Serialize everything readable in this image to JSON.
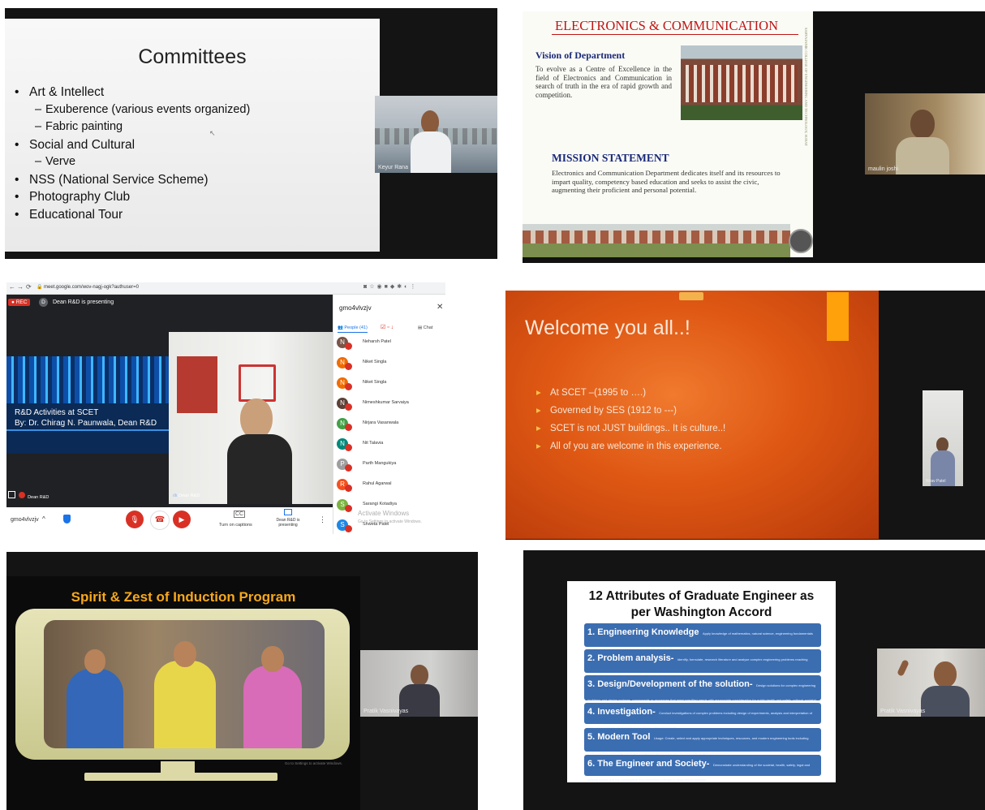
{
  "panel1": {
    "title": "Committees",
    "items": [
      {
        "level": 1,
        "text": "Art & Intellect"
      },
      {
        "level": 2,
        "text": "Exuberence (various events organized)"
      },
      {
        "level": 2,
        "text": "Fabric painting"
      },
      {
        "level": 1,
        "text": "Social and Cultural"
      },
      {
        "level": 2,
        "text": "Verve"
      },
      {
        "level": 1,
        "text": "NSS (National Service Scheme)"
      },
      {
        "level": 1,
        "text": "Photography Club"
      },
      {
        "level": 1,
        "text": "Educational Tour"
      }
    ],
    "participant": "Keyur Rana"
  },
  "panel2": {
    "title": "ELECTRONICS & COMMUNICATION",
    "vision_heading": "Vision of Department",
    "vision_text": "To evolve as a Centre of Excellence in the field of Electronics and Communication in search of truth in the era of rapid growth and competition.",
    "mission_heading": "MISSION STATEMENT",
    "mission_text": "Electronics and Communication Department dedicates itself and its resources to impart quality, competency based education and seeks to assist the civic, augmenting their proficient and personal potential.",
    "side_text": "SARVAJANIK COLLEGE OF ENGINEERING AND TECHNOLOGY, SURAT",
    "participant": "maulin joshi"
  },
  "panel3": {
    "url": "meet.google.com/wov-nagj-ogk?authuser=0",
    "rec": "REC",
    "presenter_initial": "D",
    "presenting_banner": "Dean R&D is presenting",
    "slide_line1": "R&D Activities at SCET",
    "slide_line2": "By: Dr. Chirag N. Paunwala, Dean R&D",
    "tile_left_name": "Dean R&D",
    "tile_right_name": "Dean R&D",
    "meeting_code": "gmo4vlvzjv",
    "captions_label": "Turn on captions",
    "presenting_label": "Dean R&D is presenting",
    "sidebar_title": "gmo4vlvzjv",
    "people_tab": "People (41)",
    "chat_tab": "Chat",
    "watermark1": "Activate Windows",
    "watermark2": "Go to Settings to activate Windows.",
    "people": [
      {
        "initial": "N",
        "color": "#795548",
        "name": "Neharsh Patel"
      },
      {
        "initial": "N",
        "color": "#ef6c00",
        "name": "Niket Singla"
      },
      {
        "initial": "N",
        "color": "#ef6c00",
        "name": "Niket Singla"
      },
      {
        "initial": "N",
        "color": "#5d4037",
        "name": "Nimeshkumar Sarvaiya"
      },
      {
        "initial": "N",
        "color": "#43a047",
        "name": "Nirjara Vasanwala"
      },
      {
        "initial": "N",
        "color": "#00897b",
        "name": "Nit Talavia"
      },
      {
        "initial": "P",
        "color": "#9e9e9e",
        "name": "Parth Mangukiya"
      },
      {
        "initial": "R",
        "color": "#f4511e",
        "name": "Rahul Agarwal"
      },
      {
        "initial": "S",
        "color": "#7cb342",
        "name": "Sarangi Kotadiya"
      },
      {
        "initial": "S",
        "color": "#1e88e5",
        "name": "Shweta Patel"
      }
    ]
  },
  "panel4": {
    "title": "Welcome you all..!",
    "bullets": [
      "At SCET –(1995 to ….)",
      "Governed by SES (1912 to ---)",
      "SCET is not JUST buildings.. It is culture..!",
      "All of you are welcome in this experience."
    ],
    "participant": "Nirav Patel"
  },
  "panel5": {
    "title": "Spirit & Zest of Induction Program",
    "participant": "Pratik Vasnivayas",
    "watermark": "Go to Settings to activate Windows."
  },
  "panel6": {
    "title_line1": "12 Attributes of Graduate Engineer as",
    "title_line2": "per Washington Accord",
    "attributes": [
      {
        "head": "1. Engineering Knowledge",
        "text": "Apply knowledge of mathematics, natural science, engineering fundamentals and an engineering specialization to the solution of complex engineering problems"
      },
      {
        "head": "2. Problem analysis-",
        "text": "Identify, formulate, research literature and analyse complex engineering problems reaching substantiated conclusions using first principles of mathematics, natural sciences and engineering sciences."
      },
      {
        "head": "3. Design/Development of the solution-",
        "text": "Design solutions for complex engineering problems and design systems, components or processes that meet specified needs with appropriate consideration for public health and safety, cultural, societal and environmental considerations."
      },
      {
        "head": "4. Investigation-",
        "text": "Conduct investigations of complex problems including design of experiments, analysis and interpretation of data, and synthesis of information to provide valid conclusions."
      },
      {
        "head": "5. Modern Tool",
        "text": "Usage: Create, select and apply appropriate techniques, resources, and modern engineering tools including prediction and modelling, to complex engineering activities, with an understanding of the limitations."
      },
      {
        "head": "6. The Engineer and Society-",
        "text": "Demonstrate understanding of the societal, health, safety, legal and cultural issues and the consequent responsibilities relevant to engineering practice."
      }
    ],
    "participant": "Pratik Vasnivayas"
  }
}
